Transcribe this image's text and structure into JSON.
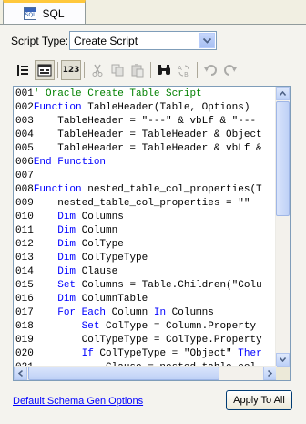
{
  "tab": {
    "label": "SQL",
    "icon": "sql-file-icon",
    "icon_text": "SQL"
  },
  "script_type": {
    "label": "Script Type:",
    "selected": "Create Script"
  },
  "toolbar": {
    "buttons": [
      "list-icon",
      "view-icon",
      "line-numbers-icon",
      "cut-icon",
      "copy-icon",
      "paste-icon",
      "find-icon",
      "replace-icon",
      "undo-icon",
      "redo-icon"
    ],
    "line_numbers_label": "123"
  },
  "editor": {
    "lines": [
      {
        "n": "001",
        "parts": [
          {
            "t": "' Oracle Create Table Script",
            "c": "cm"
          }
        ]
      },
      {
        "n": "002",
        "parts": [
          {
            "t": "Function",
            "c": "kw"
          },
          {
            "t": " TableHeader(Table, Options)",
            "c": "tx"
          }
        ]
      },
      {
        "n": "003",
        "parts": [
          {
            "t": "    TableHeader = \"---\" & vbLf & \"---",
            "c": "tx"
          }
        ]
      },
      {
        "n": "004",
        "parts": [
          {
            "t": "    TableHeader = TableHeader & Object",
            "c": "tx"
          }
        ]
      },
      {
        "n": "005",
        "parts": [
          {
            "t": "    TableHeader = TableHeader & vbLf &",
            "c": "tx"
          }
        ]
      },
      {
        "n": "006",
        "parts": [
          {
            "t": "End Function",
            "c": "kw"
          }
        ]
      },
      {
        "n": "007",
        "parts": []
      },
      {
        "n": "008",
        "parts": [
          {
            "t": "Function",
            "c": "kw"
          },
          {
            "t": " nested_table_col_properties(T",
            "c": "tx"
          }
        ]
      },
      {
        "n": "009",
        "parts": [
          {
            "t": "    nested_table_col_properties = \"\"",
            "c": "tx"
          }
        ]
      },
      {
        "n": "010",
        "parts": [
          {
            "t": "    ",
            "c": "tx"
          },
          {
            "t": "Dim",
            "c": "kw"
          },
          {
            "t": " Columns",
            "c": "tx"
          }
        ]
      },
      {
        "n": "011",
        "parts": [
          {
            "t": "    ",
            "c": "tx"
          },
          {
            "t": "Dim",
            "c": "kw"
          },
          {
            "t": " Column",
            "c": "tx"
          }
        ]
      },
      {
        "n": "012",
        "parts": [
          {
            "t": "    ",
            "c": "tx"
          },
          {
            "t": "Dim",
            "c": "kw"
          },
          {
            "t": " ColType",
            "c": "tx"
          }
        ]
      },
      {
        "n": "013",
        "parts": [
          {
            "t": "    ",
            "c": "tx"
          },
          {
            "t": "Dim",
            "c": "kw"
          },
          {
            "t": " ColTypeType",
            "c": "tx"
          }
        ]
      },
      {
        "n": "014",
        "parts": [
          {
            "t": "    ",
            "c": "tx"
          },
          {
            "t": "Dim",
            "c": "kw"
          },
          {
            "t": " Clause",
            "c": "tx"
          }
        ]
      },
      {
        "n": "015",
        "parts": [
          {
            "t": "    ",
            "c": "tx"
          },
          {
            "t": "Set",
            "c": "kw"
          },
          {
            "t": " Columns = Table.Children(\"Colu",
            "c": "tx"
          }
        ]
      },
      {
        "n": "016",
        "parts": [
          {
            "t": "    ",
            "c": "tx"
          },
          {
            "t": "Dim",
            "c": "kw"
          },
          {
            "t": " ColumnTable",
            "c": "tx"
          }
        ]
      },
      {
        "n": "017",
        "parts": [
          {
            "t": "    ",
            "c": "tx"
          },
          {
            "t": "For Each",
            "c": "kw"
          },
          {
            "t": " Column ",
            "c": "tx"
          },
          {
            "t": "In",
            "c": "kw"
          },
          {
            "t": " Columns",
            "c": "tx"
          }
        ]
      },
      {
        "n": "018",
        "parts": [
          {
            "t": "        ",
            "c": "tx"
          },
          {
            "t": "Set",
            "c": "kw"
          },
          {
            "t": " ColType = Column.Property",
            "c": "tx"
          }
        ]
      },
      {
        "n": "019",
        "parts": [
          {
            "t": "        ColTypeType = ColType.Property",
            "c": "tx"
          }
        ]
      },
      {
        "n": "020",
        "parts": [
          {
            "t": "        ",
            "c": "tx"
          },
          {
            "t": "If",
            "c": "kw"
          },
          {
            "t": " ColTypeType = \"Object\" ",
            "c": "tx"
          },
          {
            "t": "Ther",
            "c": "kw"
          }
        ]
      },
      {
        "n": "021",
        "parts": [
          {
            "t": "            Clause = nested_table_col",
            "c": "tx"
          }
        ]
      }
    ]
  },
  "footer": {
    "link": "Default Schema Gen Options",
    "apply_button": "Apply To All"
  },
  "colors": {
    "keyword": "#0000ff",
    "comment": "#008000",
    "tab_accent": "#ffc83c",
    "link": "#0000ff"
  }
}
